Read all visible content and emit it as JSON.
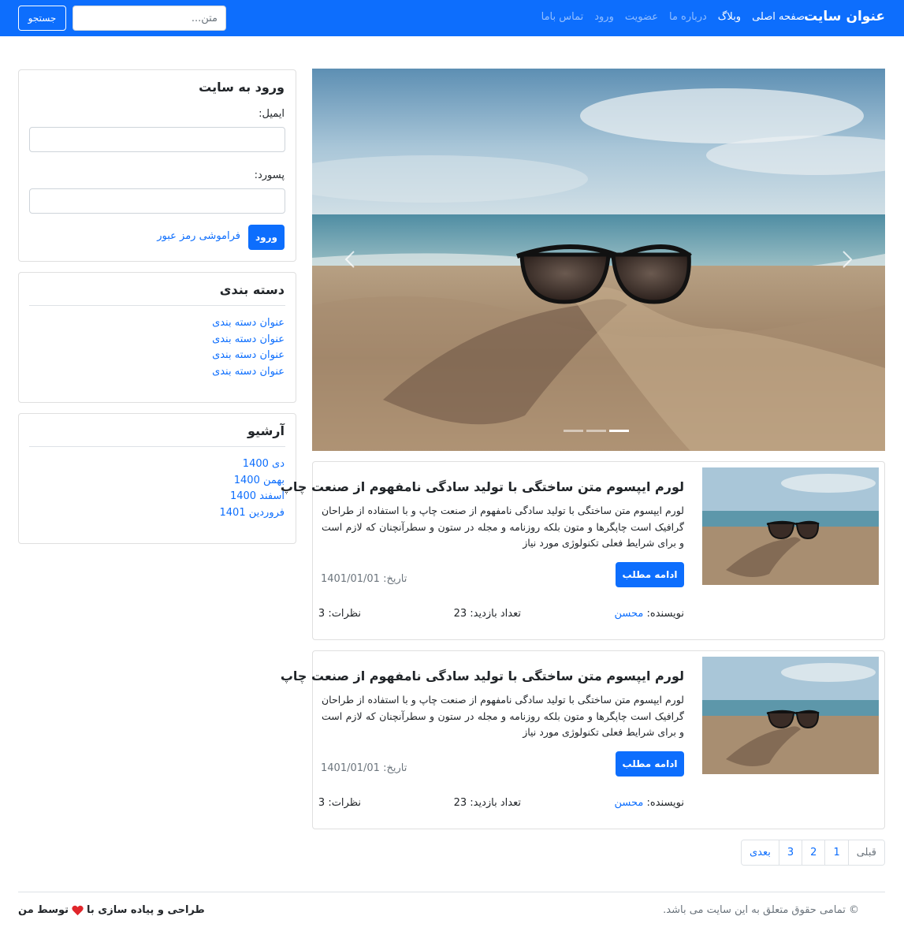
{
  "navbar": {
    "brand": "عنوان سایت",
    "links": [
      "صفحه اصلی",
      "وبلاگ",
      "درباره ما",
      "عضویت",
      "ورود",
      "تماس باما"
    ],
    "search_placeholder": "متن...",
    "search_button": "جستجو",
    "color": "#0d6efd"
  },
  "login": {
    "title": "ورود به سایت",
    "email_label": "ایمیل:",
    "password_label": "پسورد:",
    "submit": "ورود",
    "forgot": "فراموشی رمز عبور"
  },
  "categories": {
    "title": "دسته بندی",
    "items": [
      "عنوان دسته بندی",
      "عنوان دسته بندی",
      "عنوان دسته بندی",
      "عنوان دسته بندی"
    ]
  },
  "archive": {
    "title": "آرشیو",
    "items": [
      "دی 1400",
      "بهمن 1400",
      "اسفند 1400",
      "فروردین 1401"
    ]
  },
  "carousel": {
    "slides": 3,
    "active_index": 2,
    "image": "sunglasses-on-beach-sand"
  },
  "posts": [
    {
      "title": "لورم ایپسوم متن ساختگی با تولید سادگی نامفهوم از صنعت چاپ",
      "excerpt": "لورم ایپسوم متن ساختگی با تولید سادگی نامفهوم از صنعت چاپ و با استفاده از طراحان گرافیک است چاپگرها و متون بلکه روزنامه و مجله در ستون و سطرآنچنان که لازم است و برای شرایط فعلی تکنولوژی مورد نیاز",
      "more": "ادامه مطلب",
      "date_label": "تاریخ:",
      "date": "1401/01/01",
      "author_label": "نویسنده:",
      "author": "محسن",
      "views_label": "تعداد بازدید:",
      "views": "23",
      "comments_label": "نظرات:",
      "comments": "3"
    },
    {
      "title": "لورم ایپسوم متن ساختگی با تولید سادگی نامفهوم از صنعت چاپ",
      "excerpt": "لورم ایپسوم متن ساختگی با تولید سادگی نامفهوم از صنعت چاپ و با استفاده از طراحان گرافیک است چاپگرها و متون بلکه روزنامه و مجله در ستون و سطرآنچنان که لازم است و برای شرایط فعلی تکنولوژی مورد نیاز",
      "more": "ادامه مطلب",
      "date_label": "تاریخ:",
      "date": "1401/01/01",
      "author_label": "نویسنده:",
      "author": "محسن",
      "views_label": "تعداد بازدید:",
      "views": "23",
      "comments_label": "نظرات:",
      "comments": "3"
    }
  ],
  "pagination": {
    "prev": "قبلی",
    "pages": [
      "1",
      "2",
      "3"
    ],
    "next": "بعدی"
  },
  "footer": {
    "copyright": "© تمامی حقوق متعلق به این سایت می باشد.",
    "credit_before": "طراحی و پیاده سازی با",
    "credit_after": "توسط من"
  }
}
